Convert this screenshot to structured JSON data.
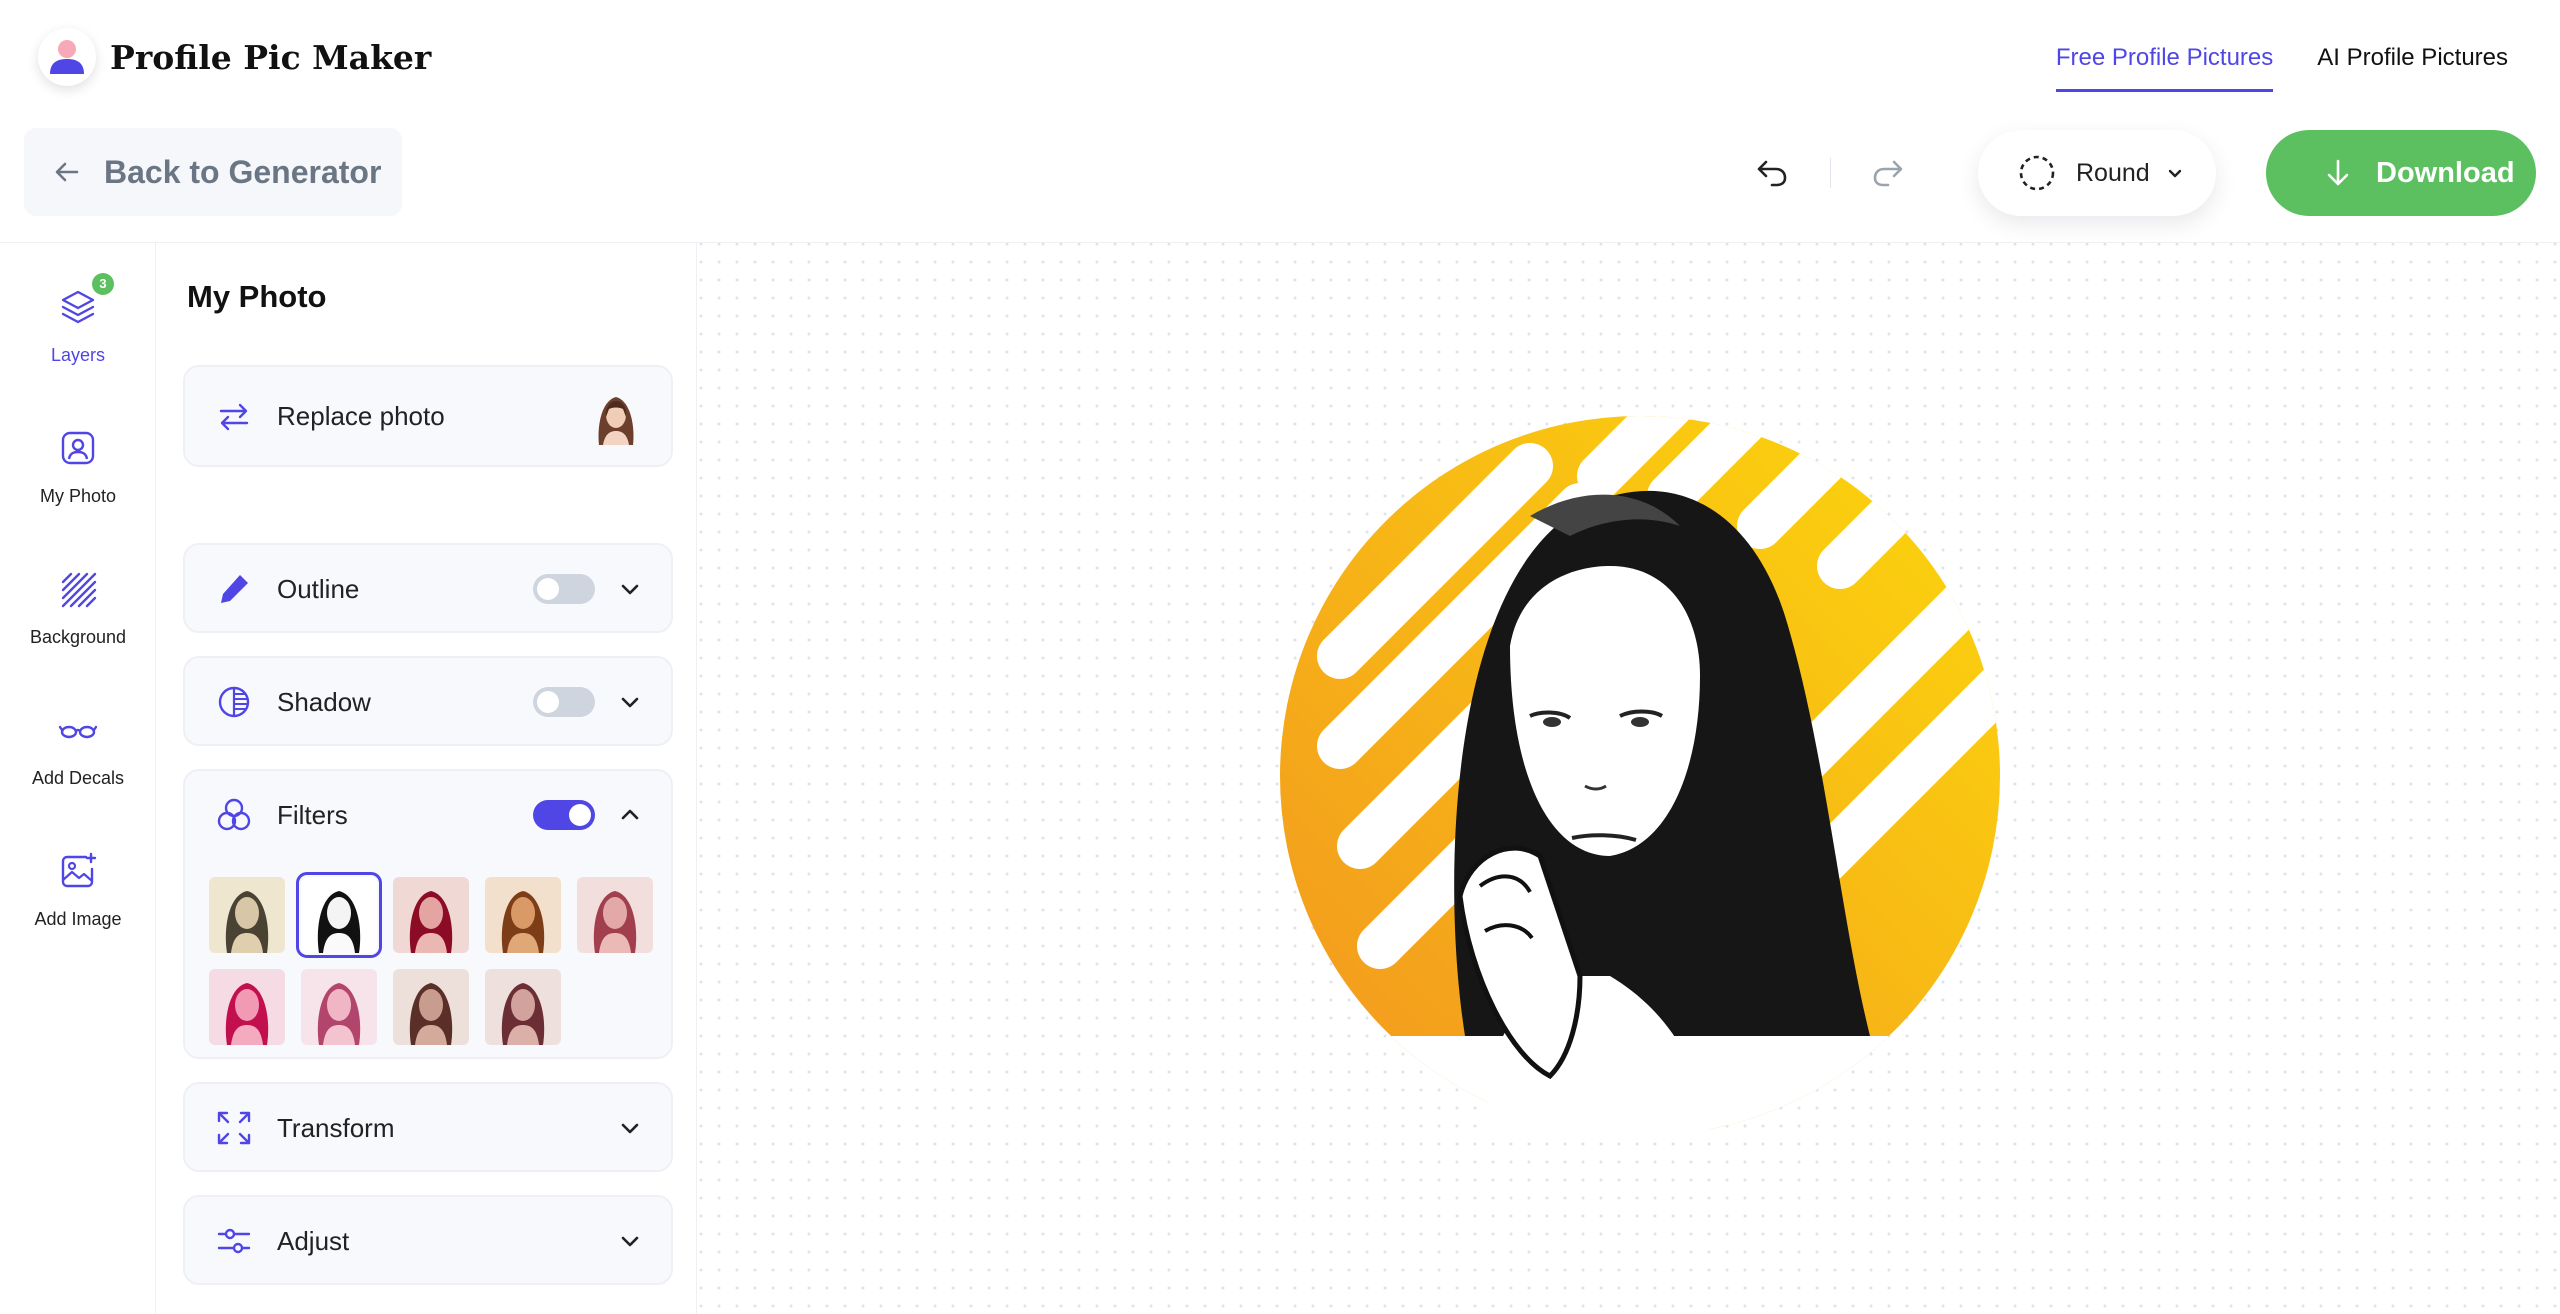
{
  "app": {
    "name": "Profile Pic Maker"
  },
  "nav": {
    "links": [
      {
        "label": "Free Profile Pictures",
        "active": true
      },
      {
        "label": "AI Profile Pictures",
        "active": false
      }
    ]
  },
  "toolbar": {
    "back_label": "Back to Generator",
    "shape_label": "Round",
    "download_label": "Download"
  },
  "rail": {
    "layers_badge": "3",
    "items": [
      {
        "label": "Layers",
        "icon": "layers-icon",
        "active": true
      },
      {
        "label": "My Photo",
        "icon": "user-square-icon",
        "active": false
      },
      {
        "label": "Background",
        "icon": "diagonal-lines-icon",
        "active": false
      },
      {
        "label": "Add Decals",
        "icon": "glasses-icon",
        "active": false
      },
      {
        "label": "Add Image",
        "icon": "image-plus-icon",
        "active": false
      }
    ]
  },
  "panel": {
    "title": "My Photo",
    "sections": {
      "replace": {
        "label": "Replace photo",
        "icon": "swap-arrows-icon"
      },
      "outline": {
        "label": "Outline",
        "icon": "pen-icon",
        "enabled": false
      },
      "shadow": {
        "label": "Shadow",
        "icon": "shadow-circle-icon",
        "enabled": false
      },
      "filters": {
        "label": "Filters",
        "icon": "three-circles-icon",
        "enabled": true,
        "expanded": true
      },
      "transform": {
        "label": "Transform",
        "icon": "expand-arrows-icon"
      },
      "adjust": {
        "label": "Adjust",
        "icon": "sliders-icon"
      }
    },
    "filters": [
      {
        "name": "original",
        "selected": false
      },
      {
        "name": "black-white",
        "selected": true
      },
      {
        "name": "red",
        "selected": false
      },
      {
        "name": "sepia-warm",
        "selected": false
      },
      {
        "name": "rose",
        "selected": false
      },
      {
        "name": "magenta",
        "selected": false
      },
      {
        "name": "pink",
        "selected": false
      },
      {
        "name": "brown",
        "selected": false
      },
      {
        "name": "muted-rose",
        "selected": false
      }
    ]
  },
  "colors": {
    "accent": "#5046e5",
    "download": "#5cc060",
    "ring_from": "#f39a1e",
    "ring_to": "#fcd20f"
  }
}
